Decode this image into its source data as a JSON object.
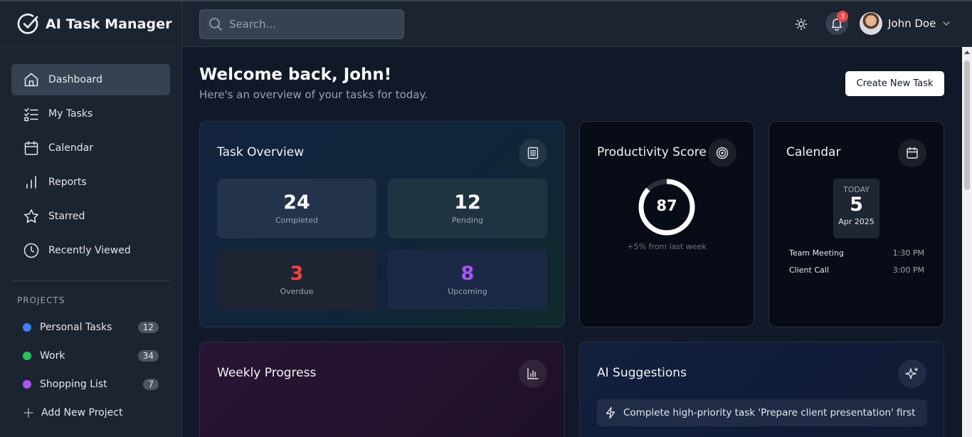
{
  "app": {
    "title": "AI Task Manager"
  },
  "search": {
    "placeholder": "Search..."
  },
  "header": {
    "notifications_count": "3",
    "user_name": "John Doe"
  },
  "sidebar": {
    "items": [
      {
        "label": "Dashboard",
        "icon": "home-icon",
        "active": true
      },
      {
        "label": "My Tasks",
        "icon": "checklist-icon"
      },
      {
        "label": "Calendar",
        "icon": "calendar-icon"
      },
      {
        "label": "Reports",
        "icon": "bar-chart-icon"
      },
      {
        "label": "Starred",
        "icon": "star-icon"
      },
      {
        "label": "Recently Viewed",
        "icon": "clock-icon"
      }
    ],
    "projects_heading": "PROJECTS",
    "projects": [
      {
        "name": "Personal Tasks",
        "count": "12",
        "color": "#3b82f6"
      },
      {
        "name": "Work",
        "count": "34",
        "color": "#22c55e"
      },
      {
        "name": "Shopping List",
        "count": "7",
        "color": "#a855f7"
      }
    ],
    "add_project_label": "Add New Project"
  },
  "main": {
    "welcome": "Welcome back, John!",
    "subtitle": "Here's an overview of your tasks for today.",
    "create_button": "Create New Task"
  },
  "task_overview": {
    "title": "Task Overview",
    "stats": [
      {
        "value": "24",
        "label": "Completed",
        "color": "#ffffff"
      },
      {
        "value": "12",
        "label": "Pending",
        "color": "#ffffff"
      },
      {
        "value": "3",
        "label": "Overdue",
        "color": "#ef4444"
      },
      {
        "value": "8",
        "label": "Upcoming",
        "color": "#a855f7"
      }
    ]
  },
  "productivity": {
    "title": "Productivity Score",
    "score": "87",
    "score_fraction": 0.87,
    "change": "+5% from last week"
  },
  "calendar": {
    "title": "Calendar",
    "today_label": "TODAY",
    "day": "5",
    "month_year": "Apr 2025",
    "events": [
      {
        "name": "Team Meeting",
        "time": "1:30 PM"
      },
      {
        "name": "Client Call",
        "time": "3:00 PM"
      }
    ]
  },
  "weekly": {
    "title": "Weekly Progress"
  },
  "ai": {
    "title": "AI Suggestions",
    "suggestions": [
      "Complete high-priority task 'Prepare client presentation' first"
    ]
  }
}
